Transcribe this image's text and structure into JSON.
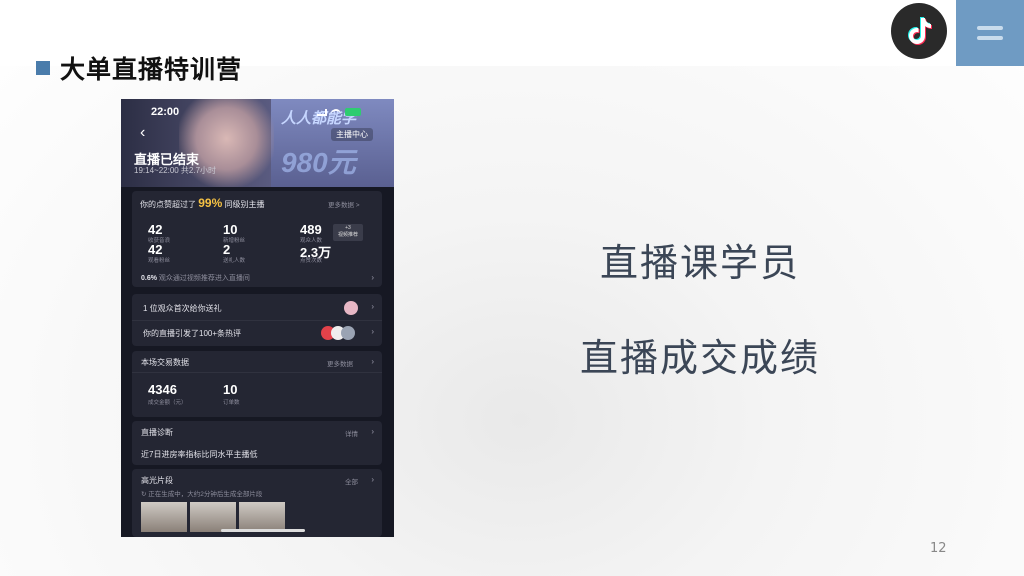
{
  "slide": {
    "title": "大单直播特训营",
    "right_line1": "直播课学员",
    "right_line2": "直播成交成绩",
    "page_number": "12"
  },
  "icons": {
    "brand": "tiktok-icon",
    "menu": "menu-icon"
  },
  "colors": {
    "accent": "#4a7cab",
    "menu_bg": "#6f9bc3",
    "text": "#3b4656"
  },
  "phone": {
    "status_time": "22:00",
    "promo_line1": "人人都能学",
    "promo_line2": "980元",
    "anchor_center": "主播中心",
    "ended_title": "直播已结束",
    "ended_sub": "19:14~22:00 共2.7小时",
    "likes": {
      "prefix": "你的点赞超过了",
      "percent": "99%",
      "suffix": "同级别主播",
      "more": "更多数据 >"
    },
    "stats": [
      {
        "value": "42",
        "label": "收获音浪"
      },
      {
        "value": "10",
        "label": "新增粉丝"
      },
      {
        "value": "489",
        "label": "观众人数"
      },
      {
        "value": "42",
        "label": "观看粉丝"
      },
      {
        "value": "2",
        "label": "送礼人数"
      },
      {
        "value": "2.3万",
        "label": "点赞次数"
      }
    ],
    "video_tag_value": "+3",
    "video_tag_label": "视频推荐",
    "recommend_pct": "0.6%",
    "recommend_text": "观众通过视频推荐进入直播间",
    "gift_row": "1 位观众首次给你送礼",
    "comment_row": "你的直播引发了100+条热评",
    "trade_title": "本场交易数据",
    "trade_more": "更多数据",
    "trade_amount": "4346",
    "trade_amount_label": "成交金额（元）",
    "trade_orders": "10",
    "trade_orders_label": "订单数",
    "diag_title": "直播诊断",
    "diag_more": "详情",
    "diag_text": "近7日进房率指标比同水平主播低",
    "highlight_title": "高光片段",
    "highlight_more": "全部",
    "highlight_text": "正在生成中，大约2分钟后生成全部片段"
  }
}
